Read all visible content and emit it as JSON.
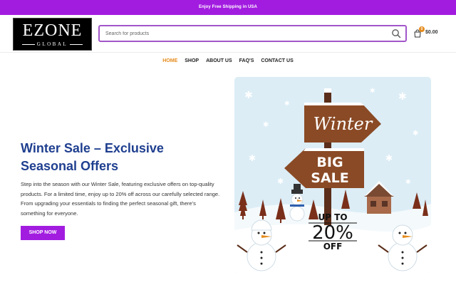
{
  "promo": {
    "text": "Enjoy Free Shipping in USA"
  },
  "logo": {
    "main": "EZONE",
    "sub": "GLOBAL"
  },
  "search": {
    "placeholder": "Search for products"
  },
  "cart": {
    "count": "0",
    "total": "$0.00"
  },
  "nav": {
    "items": [
      {
        "label": "HOME",
        "active": true
      },
      {
        "label": "SHOP"
      },
      {
        "label": "ABOUT US"
      },
      {
        "label": "FAQ'S"
      },
      {
        "label": "CONTACT US"
      }
    ]
  },
  "hero": {
    "title": "Winter Sale – Exclusive Seasonal Offers",
    "text": "Step into the season with our Winter Sale, featuring exclusive offers on top-quality products. For a limited time, enjoy up to 20% off across our carefully selected range. From upgrading your essentials to finding the perfect seasonal gift, there’s something for everyone.",
    "button": "SHOP NOW"
  },
  "banner": {
    "sign_top": "Winter",
    "sign_mid_1": "BIG",
    "sign_mid_2": "SALE",
    "up_to": "UP TO",
    "percent": "20%",
    "off": "OFF"
  },
  "colors": {
    "brand_purple": "#a21ce0",
    "title_blue": "#1f3f8f",
    "accent_orange": "#e58b1c"
  }
}
